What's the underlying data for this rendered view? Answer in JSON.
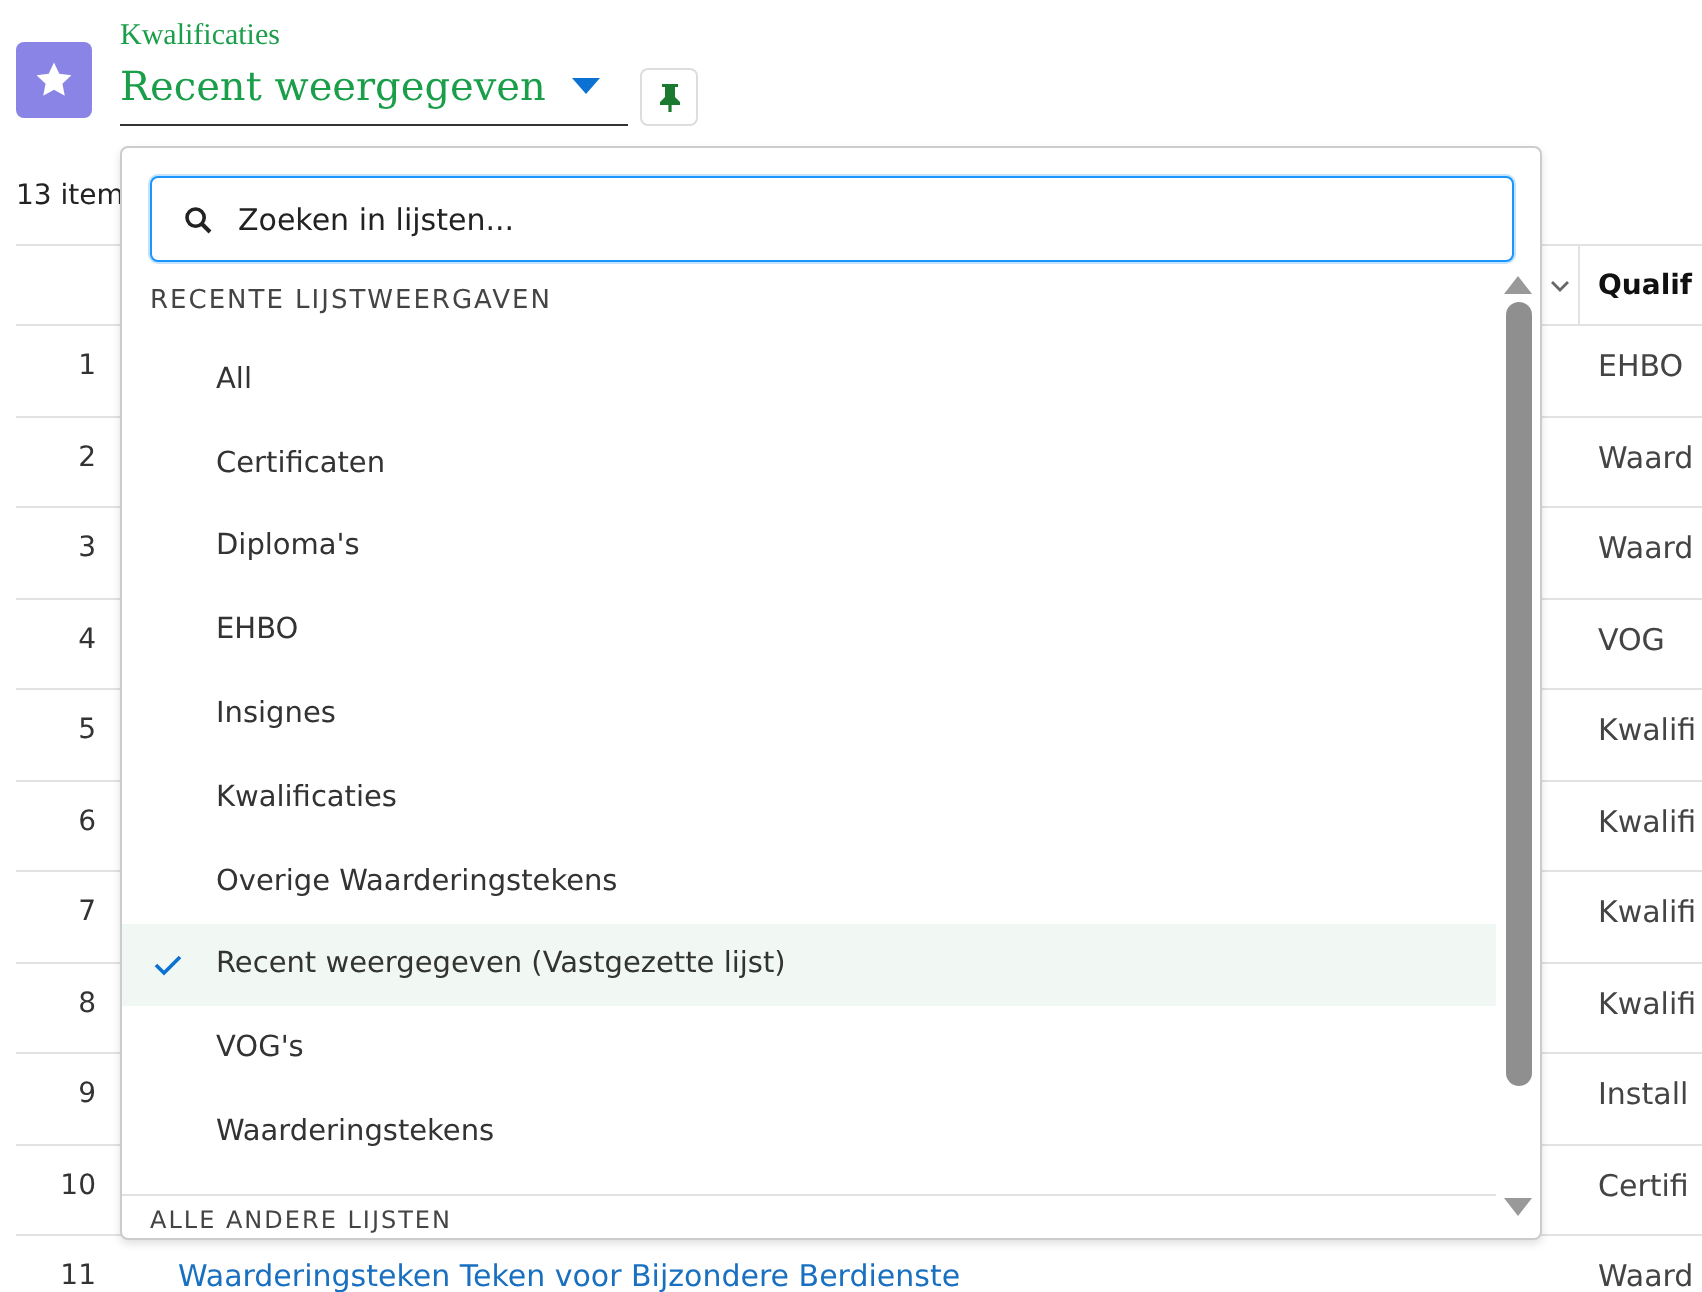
{
  "header": {
    "object_label": "Kwalificaties",
    "view_title": "Recent weergegeven",
    "pinned": true
  },
  "item_count": "13 item",
  "table": {
    "header_last": "Qualif",
    "rows": [
      {
        "number": "1",
        "link": "",
        "qualification": "EHBO"
      },
      {
        "number": "2",
        "link": "",
        "qualification": "Waard"
      },
      {
        "number": "3",
        "link": "",
        "qualification": "Waard"
      },
      {
        "number": "4",
        "link": "",
        "qualification": "VOG"
      },
      {
        "number": "5",
        "link": "",
        "qualification": "Kwalifi"
      },
      {
        "number": "6",
        "link": "",
        "qualification": "Kwalifi"
      },
      {
        "number": "7",
        "link": "",
        "qualification": "Kwalifi"
      },
      {
        "number": "8",
        "link": "",
        "qualification": "Kwalifi"
      },
      {
        "number": "9",
        "link": "",
        "qualification": "Install"
      },
      {
        "number": "10",
        "link": "",
        "qualification": "Certifi"
      },
      {
        "number": "11",
        "link": "Waarderingsteken Teken voor Bijzondere Berdienste",
        "qualification": "Waard"
      }
    ]
  },
  "dropdown": {
    "search": {
      "placeholder": "Zoeken in lijsten..."
    },
    "sections": [
      {
        "title": "RECENTE LIJSTWEERGAVEN",
        "items": [
          {
            "label": "All",
            "selected": false
          },
          {
            "label": "Certificaten",
            "selected": false
          },
          {
            "label": "Diploma's",
            "selected": false
          },
          {
            "label": "EHBO",
            "selected": false
          },
          {
            "label": "Insignes",
            "selected": false
          },
          {
            "label": "Kwalificaties",
            "selected": false
          },
          {
            "label": "Overige Waarderingstekens",
            "selected": false
          },
          {
            "label": "Recent weergegeven (Vastgezette lijst)",
            "selected": true
          },
          {
            "label": "VOG's",
            "selected": false
          },
          {
            "label": "Waarderingstekens",
            "selected": false
          }
        ]
      },
      {
        "title": "ALLE ANDERE LIJSTEN"
      }
    ]
  }
}
